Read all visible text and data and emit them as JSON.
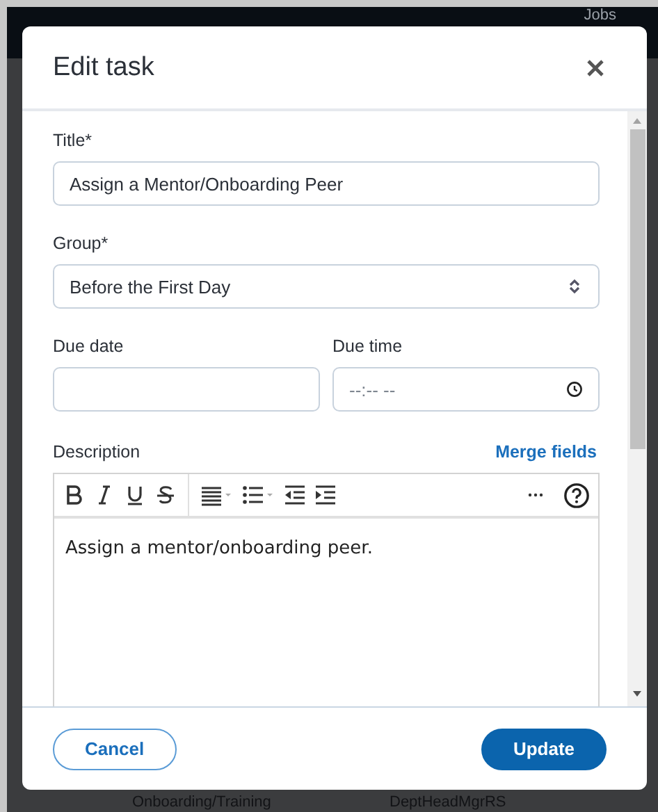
{
  "background": {
    "header_text": "Jobs",
    "row_texts": [
      "Onboarding/Training",
      "DeptHeadMgrRS"
    ]
  },
  "dialog": {
    "title": "Edit task",
    "fields": [
      {
        "kind": "text",
        "label": "Title*",
        "value": "Assign a Mentor/Onboarding Peer"
      },
      {
        "kind": "select",
        "label": "Group*",
        "value": "Before the First Day"
      }
    ],
    "due": [
      {
        "kind": "date",
        "label": "Due date"
      },
      {
        "kind": "time",
        "label": "Due time",
        "placeholder": "--:-- --"
      }
    ],
    "description": {
      "label": "Description",
      "link": "Merge fields",
      "text": "Assign a mentor/onboarding peer."
    },
    "buttons": [
      {
        "label": "Cancel",
        "kind": "secondary"
      },
      {
        "label": "Update",
        "kind": "primary"
      }
    ]
  }
}
